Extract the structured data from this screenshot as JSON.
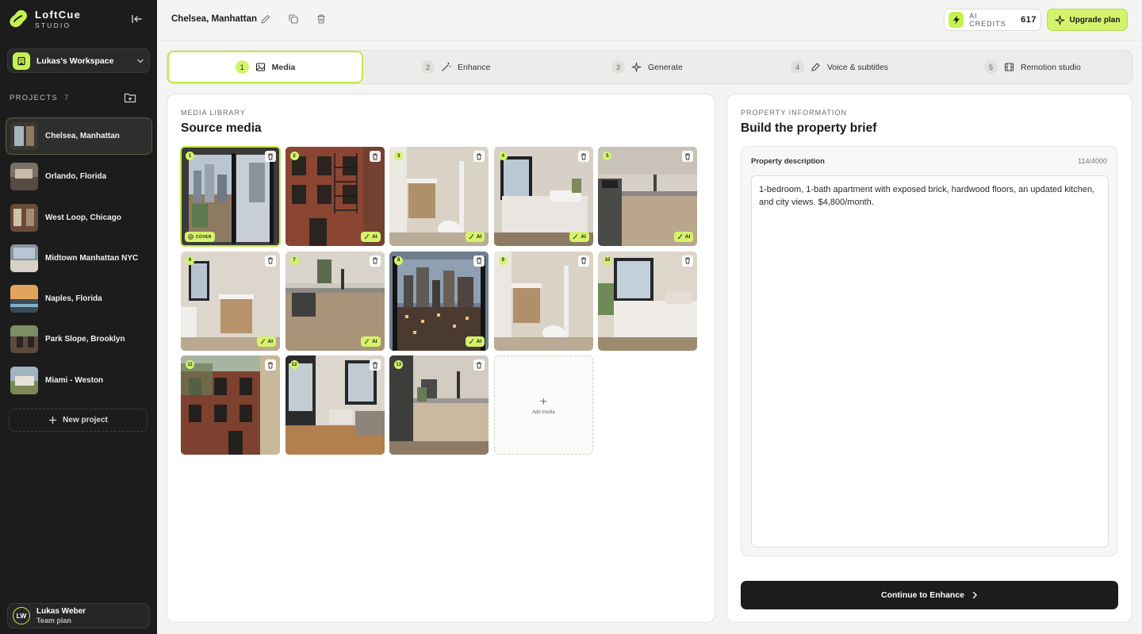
{
  "brand": {
    "name": "LoftCue",
    "sub": "STUDIO"
  },
  "workspace": {
    "label": "Lukas's Workspace"
  },
  "projects": {
    "heading": "PROJECTS",
    "count": "7",
    "items": [
      {
        "label": "Chelsea, Manhattan",
        "active": true
      },
      {
        "label": "Orlando, Florida"
      },
      {
        "label": "West Loop, Chicago"
      },
      {
        "label": "Midtown Manhattan NYC"
      },
      {
        "label": "Naples, Florida"
      },
      {
        "label": "Park Slope, Brooklyn"
      },
      {
        "label": "Miami - Weston"
      }
    ],
    "new_label": "New project"
  },
  "user": {
    "initials": "LW",
    "name": "Lukas Weber",
    "plan": "Team plan"
  },
  "topbar": {
    "title": "Chelsea, Manhattan",
    "credits_label": "AI CREDITS",
    "credits_value": "617",
    "upgrade_label": "Upgrade plan"
  },
  "steps": [
    {
      "num": "1",
      "label": "Media",
      "icon": "image-icon",
      "active": true
    },
    {
      "num": "2",
      "label": "Enhance",
      "icon": "wand-icon"
    },
    {
      "num": "3",
      "label": "Generate",
      "icon": "sparkle-icon"
    },
    {
      "num": "4",
      "label": "Voice & subtitles",
      "icon": "mic-icon"
    },
    {
      "num": "5",
      "label": "Remotion studio",
      "icon": "film-icon"
    }
  ],
  "media": {
    "eyebrow": "MEDIA LIBRARY",
    "title": "Source media",
    "ai_badge": "AI",
    "cover_badge": "COVER",
    "add_label": "Add media",
    "tiles": [
      {
        "num": "1",
        "scene": "window-view",
        "badge": "cover"
      },
      {
        "num": "2",
        "scene": "brick-facade",
        "badge": "ai"
      },
      {
        "num": "3",
        "scene": "bathroom",
        "badge": "ai"
      },
      {
        "num": "4",
        "scene": "bedroom",
        "badge": "ai"
      },
      {
        "num": "5",
        "scene": "kitchen",
        "badge": "ai"
      },
      {
        "num": "6",
        "scene": "bathroom-sink",
        "badge": "ai"
      },
      {
        "num": "7",
        "scene": "kitchen-sink",
        "badge": "ai"
      },
      {
        "num": "8",
        "scene": "city-night",
        "badge": "ai"
      },
      {
        "num": "9",
        "scene": "bathroom",
        "badge": "none"
      },
      {
        "num": "10",
        "scene": "bedroom-bright",
        "badge": "none"
      },
      {
        "num": "11",
        "scene": "brick-street",
        "badge": "none"
      },
      {
        "num": "12",
        "scene": "living-room",
        "badge": "none"
      },
      {
        "num": "13",
        "scene": "kitchen-wide",
        "badge": "none"
      }
    ]
  },
  "property": {
    "eyebrow": "PROPERTY INFORMATION",
    "title": "Build the property brief",
    "desc_label": "Property description",
    "desc_count": "114/4000",
    "description": "1-bedroom, 1-bath apartment with exposed brick, hardwood floors, an updated kitchen, and city views. $4,800/month.",
    "continue_label": "Continue to Enhance"
  },
  "colors": {
    "accent": "#d4f36a",
    "sidebar": "#1c1c1c",
    "primary_button": "#1c1c1c"
  }
}
